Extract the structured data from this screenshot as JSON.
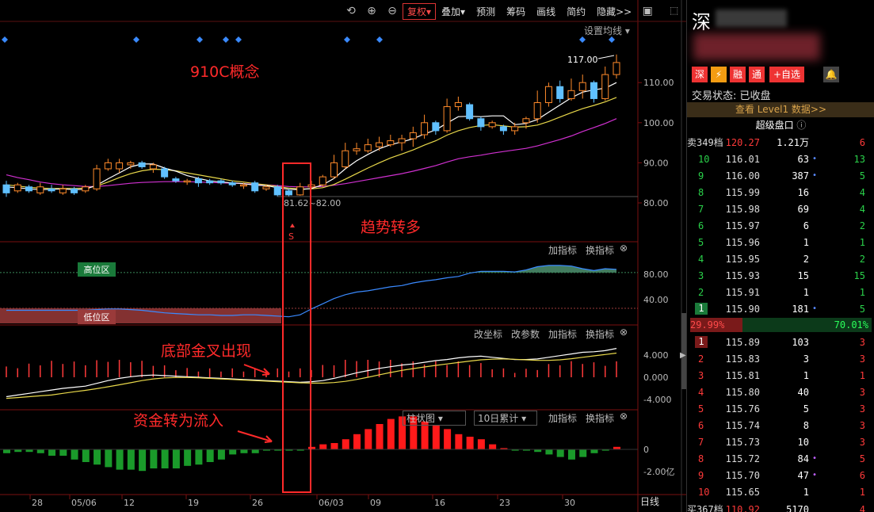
{
  "toolbar": {
    "fuquan": "复权▾",
    "diejia": "叠加▾",
    "yuce": "预测",
    "choumа": "筹码",
    "huaxian": "画线",
    "jianyue": "简约",
    "yincang": "隐藏>>"
  },
  "ma_settings": "设置均线 ▾",
  "high_marker": "117.00",
  "low_marker": "81.62~82.00",
  "s_marker": "S",
  "price_axis": [
    "110.00",
    "100.00",
    "90.00",
    "80.00"
  ],
  "osc_axis": [
    "80.00",
    "40.00"
  ],
  "macd_axis": [
    "4.000",
    "0.000",
    "-4.000"
  ],
  "flow_axis": [
    "0",
    "-2.00亿"
  ],
  "zone_high": "高位区",
  "zone_low": "低位区",
  "panel_btns": {
    "add": "加指标",
    "swap": "换指标",
    "coord": "改坐标",
    "param": "改参数",
    "style": "柱状图 ▾",
    "period": "10日累计 ▾"
  },
  "x_labels": [
    "28",
    "05/06",
    "12",
    "19",
    "26",
    "06/03",
    "09",
    "16",
    "23",
    "30"
  ],
  "x_unit": "日线",
  "annotations": {
    "concept": "910C概念",
    "trend": "趋势转多",
    "cross": "底部金叉出现",
    "flow": "资金转为流入"
  },
  "side": {
    "title_char": "深",
    "tags": [
      "深",
      "⚡",
      "融",
      "通"
    ],
    "add_watch": "+自选",
    "status": "交易状态: 已收盘",
    "level1": "查看 Level1 数据>>",
    "super": "超级盘口",
    "sell_total": {
      "label": "卖349档",
      "price": "120.27",
      "vol": "1.21万",
      "count": "6"
    },
    "asks": [
      {
        "lvl": "10",
        "price": "116.01",
        "vol": "63",
        "dot": "•",
        "cnt": "13"
      },
      {
        "lvl": "9",
        "price": "116.00",
        "vol": "387",
        "dot": "•",
        "cnt": "5"
      },
      {
        "lvl": "8",
        "price": "115.99",
        "vol": "16",
        "dot": "",
        "cnt": "4"
      },
      {
        "lvl": "7",
        "price": "115.98",
        "vol": "69",
        "dot": "",
        "cnt": "4"
      },
      {
        "lvl": "6",
        "price": "115.97",
        "vol": "6",
        "dot": "",
        "cnt": "2"
      },
      {
        "lvl": "5",
        "price": "115.96",
        "vol": "1",
        "dot": "",
        "cnt": "1"
      },
      {
        "lvl": "4",
        "price": "115.95",
        "vol": "2",
        "dot": "",
        "cnt": "2"
      },
      {
        "lvl": "3",
        "price": "115.93",
        "vol": "15",
        "dot": "",
        "cnt": "15"
      },
      {
        "lvl": "2",
        "price": "115.91",
        "vol": "1",
        "dot": "",
        "cnt": "1"
      },
      {
        "lvl": "1",
        "price": "115.90",
        "vol": "181",
        "dot": "•",
        "cnt": "5"
      }
    ],
    "ratio_left": "29.99%",
    "ratio_right": "70.01%",
    "bids": [
      {
        "lvl": "1",
        "price": "115.89",
        "vol": "103",
        "dot": "",
        "cnt": "3"
      },
      {
        "lvl": "2",
        "price": "115.83",
        "vol": "3",
        "dot": "",
        "cnt": "3"
      },
      {
        "lvl": "3",
        "price": "115.81",
        "vol": "1",
        "dot": "",
        "cnt": "1"
      },
      {
        "lvl": "4",
        "price": "115.80",
        "vol": "40",
        "dot": "",
        "cnt": "3"
      },
      {
        "lvl": "5",
        "price": "115.76",
        "vol": "5",
        "dot": "",
        "cnt": "3"
      },
      {
        "lvl": "6",
        "price": "115.74",
        "vol": "8",
        "dot": "",
        "cnt": "3"
      },
      {
        "lvl": "7",
        "price": "115.73",
        "vol": "10",
        "dot": "",
        "cnt": "3"
      },
      {
        "lvl": "8",
        "price": "115.72",
        "vol": "84",
        "dot": "•",
        "cnt": "5"
      },
      {
        "lvl": "9",
        "price": "115.70",
        "vol": "47",
        "dot": "•",
        "cnt": "6"
      },
      {
        "lvl": "10",
        "price": "115.65",
        "vol": "1",
        "dot": "",
        "cnt": "1"
      }
    ],
    "buy_total": {
      "label": "买367档",
      "price": "110.92",
      "vol": "5170",
      "count": "4"
    }
  },
  "chart_data": {
    "type": "candlestick",
    "candles": [
      [
        84.5,
        82.5,
        85.5,
        81.5
      ],
      [
        83,
        84.5,
        85,
        82.5
      ],
      [
        84,
        83,
        84.5,
        82.5
      ],
      [
        82.5,
        84,
        85,
        82
      ],
      [
        83.5,
        83,
        84.5,
        82.5
      ],
      [
        82.5,
        83.5,
        84.5,
        82
      ],
      [
        83.5,
        82.5,
        84,
        82
      ],
      [
        83,
        84,
        84.5,
        82.5
      ],
      [
        83.5,
        88.5,
        89.5,
        83
      ],
      [
        88.5,
        90,
        91,
        88
      ],
      [
        88.5,
        90,
        91,
        87.5
      ],
      [
        89.5,
        90,
        90.5,
        88.5
      ],
      [
        90,
        89,
        90.5,
        88.5
      ],
      [
        88.5,
        89.5,
        90,
        87.5
      ],
      [
        88.5,
        86.5,
        89,
        86
      ],
      [
        86,
        85.5,
        86.5,
        85
      ],
      [
        85.5,
        85.5,
        86,
        84.5
      ],
      [
        86,
        85,
        86.5,
        84
      ],
      [
        85.5,
        85,
        86,
        84.5
      ],
      [
        85.5,
        85,
        86,
        84.5
      ],
      [
        85,
        84.5,
        85.5,
        84
      ],
      [
        84.5,
        84.5,
        85,
        83.5
      ],
      [
        85,
        83,
        85.5,
        82.5
      ],
      [
        83.5,
        84,
        84.5,
        83
      ],
      [
        84,
        82,
        84.5,
        81.5
      ],
      [
        83,
        82,
        83.5,
        81.62
      ],
      [
        82,
        84,
        85,
        81.8
      ],
      [
        84,
        84.5,
        85.5,
        83.5
      ],
      [
        84.5,
        86.5,
        87,
        84
      ],
      [
        86.5,
        90,
        92,
        86
      ],
      [
        89,
        93,
        95,
        88.5
      ],
      [
        93,
        93.5,
        95,
        92
      ],
      [
        93,
        94.5,
        96,
        92.5
      ],
      [
        94,
        95,
        96.5,
        93
      ],
      [
        94.5,
        95.5,
        97,
        94
      ],
      [
        95,
        96,
        97,
        93
      ],
      [
        96,
        97.5,
        99,
        94
      ],
      [
        97,
        100,
        102,
        96
      ],
      [
        100,
        98,
        100.5,
        97
      ],
      [
        98,
        104,
        106,
        97.5
      ],
      [
        104,
        105,
        106.5,
        103
      ],
      [
        104.5,
        101,
        105,
        100.5
      ],
      [
        101,
        99,
        101.5,
        98
      ],
      [
        99,
        100,
        100.5,
        98.5
      ],
      [
        99,
        98,
        99.5,
        97
      ],
      [
        98,
        99,
        100,
        97
      ],
      [
        100,
        101,
        101.5,
        98.5
      ],
      [
        101,
        105,
        108,
        100
      ],
      [
        105,
        109,
        110,
        104
      ],
      [
        109,
        106,
        110.5,
        105
      ],
      [
        106,
        108,
        111,
        105.5
      ],
      [
        108,
        110,
        112,
        106
      ],
      [
        110,
        106,
        110.5,
        105
      ],
      [
        106,
        112,
        114,
        105.5
      ],
      [
        112,
        115,
        117,
        111
      ]
    ],
    "ma5": [
      84,
      83.8,
      83.5,
      83.3,
      83.4,
      83.5,
      83.3,
      83.4,
      84.4,
      86,
      87.5,
      89,
      89.7,
      89.7,
      88.7,
      87.9,
      86.8,
      86.1,
      85.5,
      85.2,
      85,
      84.8,
      84.4,
      84.3,
      83.8,
      83.4,
      83.3,
      83.6,
      84.5,
      86.1,
      88.5,
      90.5,
      92.1,
      93.5,
      94.5,
      95.2,
      96,
      97.2,
      98.2,
      99.9,
      101.5,
      101.6,
      101.5,
      101.7,
      101.7,
      99.5,
      99.8,
      100.8,
      102.6,
      104.4,
      106.2,
      107.6,
      108.2,
      108.6,
      110
    ]
  }
}
